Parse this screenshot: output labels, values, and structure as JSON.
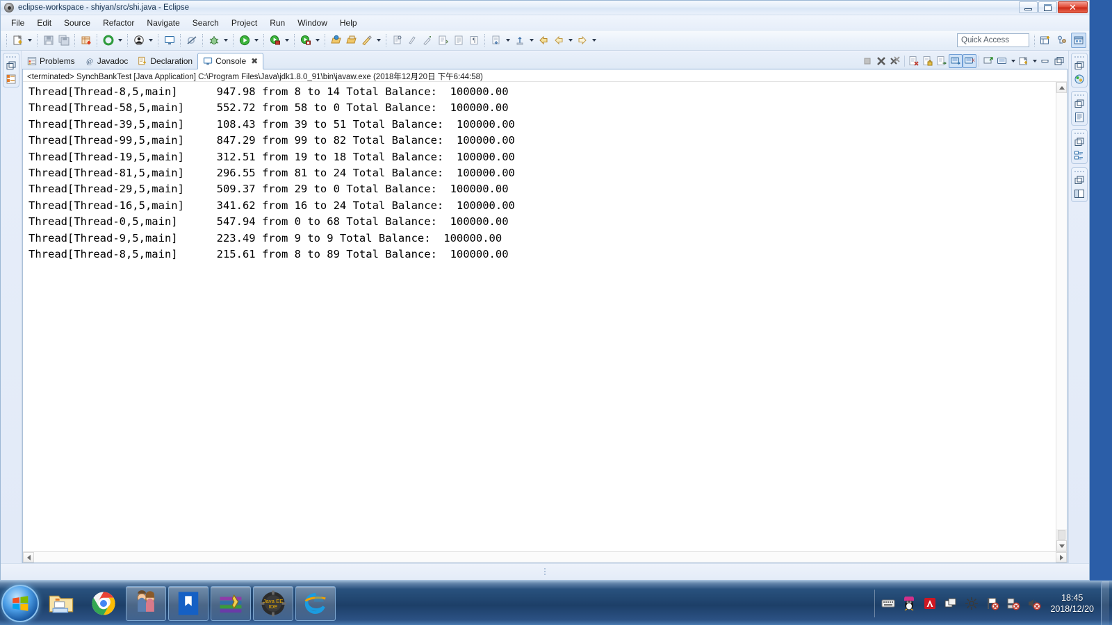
{
  "window": {
    "title": "eclipse-workspace - shiyan/src/shi.java - Eclipse",
    "icon": "eclipse-icon",
    "minimize_label": "Minimize",
    "maximize_label": "Maximize",
    "close_label": "✕"
  },
  "menubar": {
    "items": [
      {
        "label": "File",
        "name": "menu-file"
      },
      {
        "label": "Edit",
        "name": "menu-edit"
      },
      {
        "label": "Source",
        "name": "menu-source"
      },
      {
        "label": "Refactor",
        "name": "menu-refactor"
      },
      {
        "label": "Navigate",
        "name": "menu-navigate"
      },
      {
        "label": "Search",
        "name": "menu-search"
      },
      {
        "label": "Project",
        "name": "menu-project"
      },
      {
        "label": "Run",
        "name": "menu-run"
      },
      {
        "label": "Window",
        "name": "menu-window"
      },
      {
        "label": "Help",
        "name": "menu-help"
      }
    ]
  },
  "toolbar": {
    "quick_access": {
      "placeholder": "Quick Access",
      "value": "Quick Access"
    },
    "buttons": [
      "new-wizard-icon",
      "save-icon",
      "save-all-icon",
      "new-java-package-icon",
      "build-all-icon",
      "new-java-class-icon",
      "open-console-icon",
      "skip-breakpoints-icon",
      "debug-icon",
      "run-icon",
      "run-external-tools-icon",
      "coverage-icon",
      "open-type-icon",
      "open-task-icon",
      "search-icon",
      "annotation-icon",
      "next-annotation-icon",
      "previous-annotation-icon",
      "last-edit-location-icon",
      "toggle-mark-occurrences-icon",
      "back-icon",
      "forward-icon"
    ],
    "perspective": [
      "open-perspective-icon",
      "java-perspective-icon",
      "java-ee-perspective-icon"
    ]
  },
  "left_fast_view": {
    "groups": [
      {
        "restore_icon": "restore-view-icon",
        "view_icon": "package-explorer-icon"
      }
    ]
  },
  "right_fast_view": {
    "groups": [
      {
        "restore_icon": "restore-view-icon",
        "view_icon": "java-browsing-icon"
      },
      {
        "restore_icon": "restore-view-icon",
        "view_icon": "outline-icon"
      },
      {
        "restore_icon": "restore-view-icon",
        "view_icon": "task-list-icon"
      },
      {
        "restore_icon": "restore-view-icon",
        "view_icon": "layout-icon"
      }
    ]
  },
  "view_stack": {
    "tabs": [
      {
        "label": "Problems",
        "icon": "problems-icon",
        "active": false,
        "closable": false
      },
      {
        "label": "Javadoc",
        "icon": "javadoc-icon",
        "active": false,
        "closable": false
      },
      {
        "label": "Declaration",
        "icon": "declaration-icon",
        "active": false,
        "closable": false
      },
      {
        "label": "Console",
        "icon": "console-icon",
        "active": true,
        "closable": true,
        "close_glyph": "✖"
      }
    ],
    "view_toolbar": [
      {
        "name": "terminate-icon",
        "pressed": false,
        "enabled": false
      },
      {
        "name": "remove-launch-icon",
        "pressed": false,
        "enabled": true
      },
      {
        "name": "remove-all-terminated-icon",
        "pressed": false,
        "enabled": true
      },
      {
        "name": "clear-console-icon",
        "pressed": false,
        "enabled": true
      },
      {
        "name": "scroll-lock-icon",
        "pressed": false,
        "enabled": true
      },
      {
        "name": "word-wrap-icon",
        "pressed": false,
        "enabled": true
      },
      {
        "name": "show-console-on-output-icon",
        "pressed": true,
        "enabled": true
      },
      {
        "name": "show-console-on-error-icon",
        "pressed": true,
        "enabled": true
      },
      {
        "name": "pin-console-icon",
        "pressed": false,
        "enabled": true
      },
      {
        "name": "display-selected-console-icon",
        "pressed": false,
        "enabled": true
      },
      {
        "name": "open-console-icon",
        "pressed": false,
        "enabled": true
      }
    ],
    "minimize_label": "Minimize",
    "maximize_label": "Maximize"
  },
  "console": {
    "header": "<terminated> SynchBankTest [Java Application] C:\\Program Files\\Java\\jdk1.8.0_91\\bin\\javaw.exe (2018年12月20日 下午6:44:58)",
    "lines": [
      "Thread[Thread-8,5,main]      947.98 from 8 to 14 Total Balance:  100000.00",
      "Thread[Thread-58,5,main]     552.72 from 58 to 0 Total Balance:  100000.00",
      "Thread[Thread-39,5,main]     108.43 from 39 to 51 Total Balance:  100000.00",
      "Thread[Thread-99,5,main]     847.29 from 99 to 82 Total Balance:  100000.00",
      "Thread[Thread-19,5,main]     312.51 from 19 to 18 Total Balance:  100000.00",
      "Thread[Thread-81,5,main]     296.55 from 81 to 24 Total Balance:  100000.00",
      "Thread[Thread-29,5,main]     509.37 from 29 to 0 Total Balance:  100000.00",
      "Thread[Thread-16,5,main]     341.62 from 16 to 24 Total Balance:  100000.00",
      "Thread[Thread-0,5,main]      547.94 from 0 to 68 Total Balance:  100000.00",
      "Thread[Thread-9,5,main]      223.49 from 9 to 9 Total Balance:  100000.00",
      "Thread[Thread-8,5,main]      215.61 from 8 to 89 Total Balance:  100000.00"
    ]
  },
  "taskbar": {
    "start_label": "Start",
    "buttons": [
      {
        "name": "taskbar-file-explorer",
        "icon": "folder-icon",
        "boxed": false
      },
      {
        "name": "taskbar-google-chrome",
        "icon": "chrome-icon",
        "boxed": false
      },
      {
        "name": "taskbar-qq",
        "icon": "qq-couple-icon",
        "boxed": true
      },
      {
        "name": "taskbar-wps-writer",
        "icon": "wps-writer-icon",
        "boxed": true
      },
      {
        "name": "taskbar-winrar",
        "icon": "winrar-icon",
        "boxed": true
      },
      {
        "name": "taskbar-eclipse-javaee",
        "icon": "java-ee-ide-icon",
        "boxed": true
      },
      {
        "name": "taskbar-internet-explorer",
        "icon": "internet-explorer-icon",
        "boxed": true
      }
    ],
    "tray": [
      {
        "name": "tray-keyboard-icon"
      },
      {
        "name": "tray-qq-penguin-icon"
      },
      {
        "name": "tray-adobe-icon"
      },
      {
        "name": "tray-window-switch-icon"
      },
      {
        "name": "tray-settings-icon"
      },
      {
        "name": "tray-flag-action-center-icon"
      },
      {
        "name": "tray-network-error-icon"
      },
      {
        "name": "tray-volume-muted-icon"
      }
    ],
    "clock": {
      "time": "18:45",
      "date": "2018/12/20"
    }
  },
  "colors": {
    "accent": "#2b5ea8",
    "window_bg": "#e3ecf8",
    "console_bg": "#ffffff",
    "console_text": "#000000",
    "close_button": "#cc2a18",
    "taskbar": "#1d3f68"
  }
}
